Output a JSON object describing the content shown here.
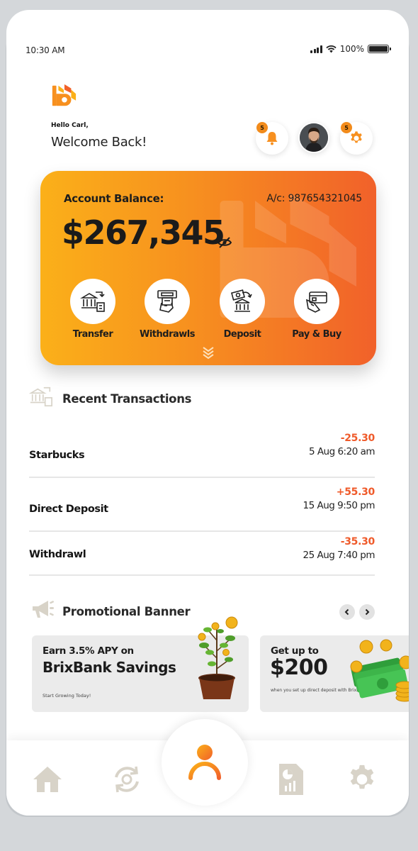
{
  "status_bar": {
    "time": "10:30 AM",
    "battery": "100%"
  },
  "header": {
    "greeting": "Hello Carl,",
    "welcome": "Welcome Back!",
    "notifications_badge": "5",
    "settings_badge": "5"
  },
  "balance_card": {
    "label": "Account Balance:",
    "account": "A/c: 987654321045",
    "amount": "$267,345",
    "actions": [
      {
        "label": "Transfer",
        "icon": "bank-transfer-icon"
      },
      {
        "label": "Withdrawls",
        "icon": "atm-withdraw-icon"
      },
      {
        "label": "Deposit",
        "icon": "cash-deposit-icon"
      },
      {
        "label": "Pay & Buy",
        "icon": "card-payment-icon"
      }
    ]
  },
  "transactions": {
    "title": "Recent Transactions",
    "items": [
      {
        "name": "Starbucks",
        "amount": "-25.30",
        "date": "5 Aug 6:20 am"
      },
      {
        "name": "Direct Deposit",
        "amount": "+55.30",
        "date": "15 Aug 9:50 pm"
      },
      {
        "name": "Withdrawl",
        "amount": "-35.30",
        "date": "25 Aug 7:40 pm"
      }
    ]
  },
  "promotions": {
    "title": "Promotional Banner",
    "banners": [
      {
        "line1": "Earn 3.5% APY on",
        "line2": "BrixBank Savings",
        "cta": "Start Growing Today!"
      },
      {
        "line1": "Get up to",
        "line2": "$200",
        "small": "when you set up direct deposit with BrixBank"
      }
    ]
  },
  "colors": {
    "accent": "#f7901f",
    "accent_dark": "#f1612a",
    "negative": "#ef5a2a",
    "nav_icon": "#d8d3c8"
  },
  "bottom_nav": [
    "home-icon",
    "exchange-icon",
    "profile-icon",
    "report-icon",
    "settings-icon"
  ]
}
